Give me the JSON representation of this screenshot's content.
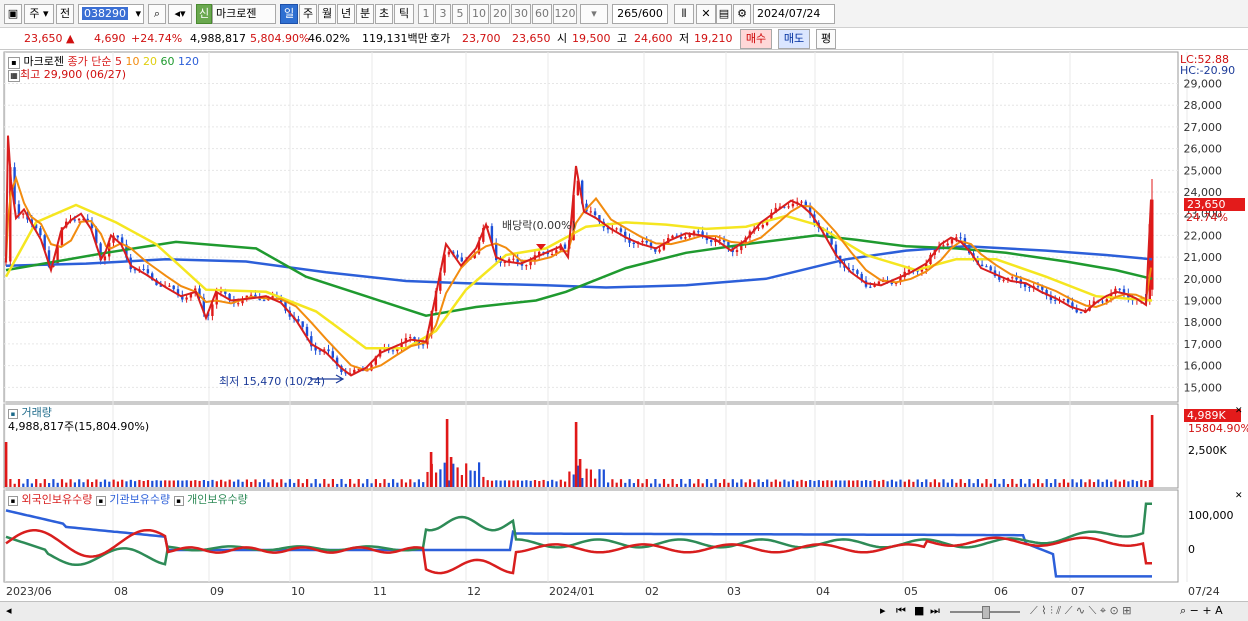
{
  "toolbar": {
    "mode_a": "주",
    "mode_b": "전",
    "stock_code": "038290",
    "badge": "신",
    "stock_name": "마크로젠",
    "periods": [
      "일",
      "주",
      "월",
      "년",
      "분",
      "초",
      "틱"
    ],
    "active_period": "일",
    "intervals": [
      "1",
      "3",
      "5",
      "10",
      "20",
      "30",
      "60",
      "120"
    ],
    "count": "265",
    "count_total": "/600",
    "date": "2024/07/24"
  },
  "info": {
    "price": "23,650",
    "up_arrow": "▲",
    "change": "4,690",
    "change_pct": "+24.74%",
    "volume": "4,988,817",
    "volume_ratio": "5,804.90%",
    "turnover_pct": "46.02%",
    "amount": "119,131백만",
    "bid_label": "호가",
    "bid1": "23,700",
    "bid2": "23,650",
    "open_label": "시",
    "open": "19,500",
    "high_label": "고",
    "high": "24,600",
    "low_label": "저",
    "low": "19,210",
    "buy_button": "매수",
    "sell_button": "매도",
    "eval_button": "평"
  },
  "legend": {
    "name": "마크로젠",
    "price_label": "종가 단순",
    "ma": [
      "5",
      "10",
      "20",
      "60",
      "120"
    ],
    "ma_colors": [
      "#d81e1e",
      "#f28c0f",
      "#f5e620",
      "#1f9a2f",
      "#2c5fd9"
    ],
    "max_label": "최고 29,900 (06/27)",
    "min_label": "최저 15,470 (10/24)",
    "dividend_label": "배당락(0.00%)",
    "lc": "LC:52.88",
    "hc": "HC:-20.90",
    "last_price": "23,650",
    "last_pct": "24.74%"
  },
  "volume_panel": {
    "title": "거래량",
    "value_label": "4,988,817주(15,804.90%)",
    "tag": "4,989K",
    "tag_pct": "15804.90%",
    "tick": "2,500K"
  },
  "holdings_panel": {
    "series": [
      "외국인보유수량",
      "기관보유수량",
      "개인보유수량"
    ],
    "series_colors": [
      "#d81e1e",
      "#2c5fd9",
      "#2e8b57"
    ],
    "ticks": [
      "100,000",
      "0"
    ]
  },
  "chart_data": {
    "type": "candlestick",
    "price_ticks": [
      "29,000",
      "28,000",
      "27,000",
      "26,000",
      "25,000",
      "24,000",
      "23,000",
      "22,000",
      "21,000",
      "20,000",
      "19,000",
      "18,000",
      "17,000",
      "16,000",
      "15,000"
    ],
    "ylim": [
      14600,
      29900
    ],
    "x_labels": [
      "2023/06",
      "08",
      "09",
      "10",
      "11",
      "12",
      "2024/01",
      "02",
      "03",
      "04",
      "05",
      "06",
      "07",
      "07/24"
    ],
    "close_points": [
      [
        0,
        20800
      ],
      [
        2,
        26600
      ],
      [
        5,
        24500
      ],
      [
        10,
        22800
      ],
      [
        18,
        23200
      ],
      [
        25,
        22600
      ],
      [
        35,
        21800
      ],
      [
        45,
        20400
      ],
      [
        55,
        22200
      ],
      [
        65,
        22700
      ],
      [
        75,
        23000
      ],
      [
        85,
        22300
      ],
      [
        95,
        20900
      ],
      [
        100,
        21300
      ],
      [
        105,
        22000
      ],
      [
        115,
        21600
      ],
      [
        125,
        20600
      ],
      [
        140,
        20200
      ],
      [
        160,
        19600
      ],
      [
        175,
        19200
      ],
      [
        190,
        19400
      ],
      [
        200,
        18200
      ],
      [
        210,
        19400
      ],
      [
        225,
        19000
      ],
      [
        245,
        19100
      ],
      [
        260,
        19200
      ],
      [
        275,
        18900
      ],
      [
        290,
        18100
      ],
      [
        305,
        17000
      ],
      [
        320,
        16600
      ],
      [
        335,
        15900
      ],
      [
        345,
        15550
      ],
      [
        360,
        15900
      ],
      [
        375,
        16600
      ],
      [
        390,
        16900
      ],
      [
        405,
        17200
      ],
      [
        420,
        17100
      ],
      [
        430,
        19300
      ],
      [
        440,
        21600
      ],
      [
        455,
        20600
      ],
      [
        470,
        21400
      ],
      [
        480,
        22500
      ],
      [
        490,
        21000
      ],
      [
        500,
        20800
      ],
      [
        515,
        20700
      ],
      [
        530,
        21000
      ],
      [
        545,
        21300
      ],
      [
        555,
        21500
      ],
      [
        562,
        21000
      ],
      [
        570,
        25200
      ],
      [
        578,
        23100
      ],
      [
        590,
        22800
      ],
      [
        605,
        22300
      ],
      [
        620,
        21900
      ],
      [
        635,
        21600
      ],
      [
        650,
        21400
      ],
      [
        665,
        21800
      ],
      [
        680,
        22100
      ],
      [
        695,
        22000
      ],
      [
        710,
        21800
      ],
      [
        725,
        21300
      ],
      [
        740,
        21800
      ],
      [
        755,
        22600
      ],
      [
        770,
        23100
      ],
      [
        785,
        23600
      ],
      [
        795,
        23400
      ],
      [
        805,
        23000
      ],
      [
        815,
        22300
      ],
      [
        830,
        21100
      ],
      [
        845,
        20300
      ],
      [
        860,
        19800
      ],
      [
        875,
        19700
      ],
      [
        890,
        20000
      ],
      [
        905,
        20300
      ],
      [
        920,
        20700
      ],
      [
        935,
        21600
      ],
      [
        945,
        21900
      ],
      [
        955,
        21700
      ],
      [
        965,
        21200
      ],
      [
        975,
        20500
      ],
      [
        990,
        20200
      ],
      [
        1005,
        19900
      ],
      [
        1020,
        19800
      ],
      [
        1035,
        19400
      ],
      [
        1050,
        19100
      ],
      [
        1065,
        18700
      ],
      [
        1080,
        18500
      ],
      [
        1090,
        18900
      ],
      [
        1100,
        19200
      ],
      [
        1110,
        19400
      ],
      [
        1120,
        19300
      ],
      [
        1130,
        19100
      ],
      [
        1140,
        18800
      ],
      [
        1145,
        23650
      ]
    ],
    "ma_lines": {
      "ma20": [
        [
          0,
          20100
        ],
        [
          30,
          22600
        ],
        [
          70,
          23400
        ],
        [
          110,
          22600
        ],
        [
          150,
          21600
        ],
        [
          200,
          19500
        ],
        [
          260,
          19400
        ],
        [
          310,
          18500
        ],
        [
          360,
          16800
        ],
        [
          400,
          16800
        ],
        [
          430,
          17600
        ],
        [
          460,
          19500
        ],
        [
          500,
          21100
        ],
        [
          540,
          21400
        ],
        [
          580,
          22400
        ],
        [
          620,
          22600
        ],
        [
          660,
          22500
        ],
        [
          700,
          22300
        ],
        [
          740,
          22400
        ],
        [
          780,
          22900
        ],
        [
          810,
          22500
        ],
        [
          860,
          21100
        ],
        [
          910,
          20400
        ],
        [
          950,
          20900
        ],
        [
          990,
          20900
        ],
        [
          1040,
          20100
        ],
        [
          1090,
          19200
        ],
        [
          1146,
          19000
        ]
      ],
      "ma60": [
        [
          0,
          20400
        ],
        [
          50,
          20800
        ],
        [
          100,
          21200
        ],
        [
          170,
          21700
        ],
        [
          250,
          21400
        ],
        [
          300,
          20100
        ],
        [
          360,
          19200
        ],
        [
          420,
          18300
        ],
        [
          470,
          18700
        ],
        [
          530,
          19000
        ],
        [
          560,
          19400
        ],
        [
          620,
          20500
        ],
        [
          680,
          21200
        ],
        [
          740,
          21600
        ],
        [
          810,
          22000
        ],
        [
          850,
          21800
        ],
        [
          900,
          21500
        ],
        [
          950,
          21400
        ],
        [
          1000,
          21200
        ],
        [
          1060,
          20800
        ],
        [
          1110,
          20400
        ],
        [
          1146,
          20000
        ]
      ],
      "ma120": [
        [
          0,
          20600
        ],
        [
          80,
          20700
        ],
        [
          160,
          20900
        ],
        [
          240,
          20800
        ],
        [
          320,
          20300
        ],
        [
          400,
          19900
        ],
        [
          460,
          19800
        ],
        [
          540,
          19700
        ],
        [
          600,
          19600
        ],
        [
          680,
          19700
        ],
        [
          760,
          20000
        ],
        [
          840,
          20900
        ],
        [
          900,
          21300
        ],
        [
          960,
          21500
        ],
        [
          1040,
          21300
        ],
        [
          1100,
          21100
        ],
        [
          1146,
          20900
        ]
      ]
    },
    "volume_spike_values": [
      2,
      9,
      1,
      1,
      10,
      1,
      2,
      15
    ]
  },
  "status": {
    "scroll_left": "◂",
    "controls": [
      "▸",
      "⏮",
      "■",
      "⏭"
    ]
  }
}
